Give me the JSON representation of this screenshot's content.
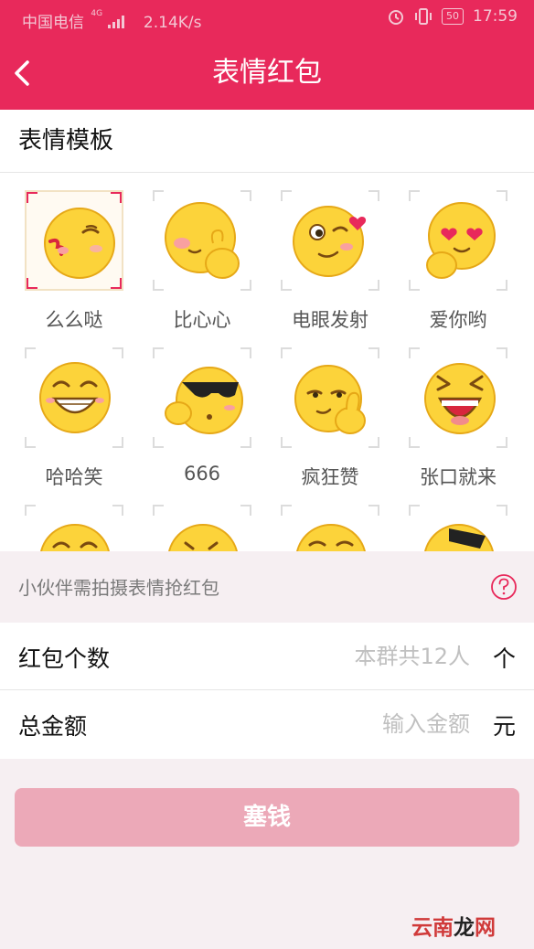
{
  "status_bar": {
    "carrier": "中国电信",
    "network": "4G",
    "speed": "2.14K/s",
    "battery": "50",
    "time": "17:59"
  },
  "nav": {
    "title": "表情红包"
  },
  "template_section": {
    "title": "表情模板",
    "selected_index": 0,
    "emojis": [
      {
        "label": "么么哒",
        "icon": "kiss-face-icon"
      },
      {
        "label": "比心心",
        "icon": "finger-heart-face-icon"
      },
      {
        "label": "电眼发射",
        "icon": "wink-heart-face-icon"
      },
      {
        "label": "爱你哟",
        "icon": "heart-eyes-face-icon"
      },
      {
        "label": "哈哈笑",
        "icon": "laughing-face-icon"
      },
      {
        "label": "666",
        "icon": "sunglasses-face-icon"
      },
      {
        "label": "疯狂赞",
        "icon": "thumbs-up-face-icon"
      },
      {
        "label": "张口就来",
        "icon": "open-mouth-face-icon"
      }
    ]
  },
  "hint": {
    "text": "小伙伴需拍摄表情抢红包"
  },
  "form": {
    "count_label": "红包个数",
    "count_placeholder": "本群共12人",
    "count_unit": "个",
    "amount_label": "总金额",
    "amount_placeholder": "输入金额",
    "amount_unit": "元"
  },
  "submit": {
    "label": "塞钱"
  },
  "watermark": {
    "text_a": "云南",
    "text_b": "龙",
    "text_c": "网"
  },
  "colors": {
    "brand": "#e8295b",
    "button_disabled": "#eca9b8",
    "emoji_yellow": "#fcd33a"
  }
}
